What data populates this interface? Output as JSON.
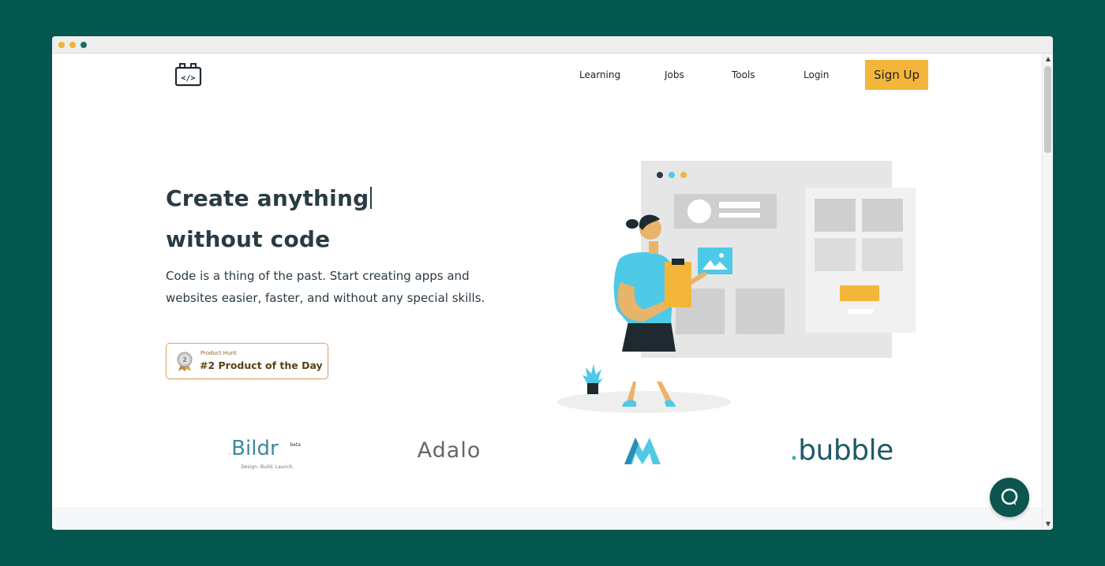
{
  "nav": {
    "learning": "Learning",
    "jobs": "Jobs",
    "tools": "Tools",
    "login": "Login",
    "signup": "Sign Up"
  },
  "hero": {
    "title_line1": "Create anything",
    "title_line2": "without code",
    "subtitle": "Code is a thing of the past. Start creating apps and websites easier, faster, and without any special skills."
  },
  "product_hunt_badge": {
    "small_label": "Product Hunt",
    "main_label": "#2 Product of the Day"
  },
  "partners": {
    "bildr": "Bildr",
    "bildr_prefix": ".",
    "bildr_tagline": "Design. Build. Launch.",
    "bildr_beta": "beta",
    "adalo": "Adalo",
    "bubble_dot": ".",
    "bubble": "bubble"
  },
  "colors": {
    "background": "#04574f",
    "accent": "#f4b63a",
    "chat_button": "#0c5550"
  },
  "icons": {
    "logo": "code-logo-icon",
    "chat": "chat-bubble-icon"
  }
}
